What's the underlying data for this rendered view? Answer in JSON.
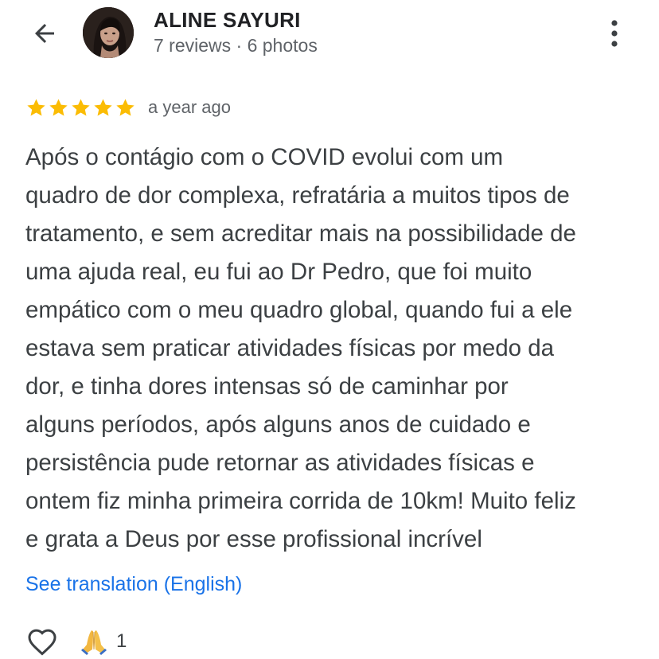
{
  "header": {
    "author_name": "ALINE SAYURI",
    "author_meta": "7 reviews · 6 photos"
  },
  "review": {
    "rating": 5,
    "rating_max": 5,
    "date": "a year ago",
    "text_lines": [
      "Após o contágio com o COVID evolui com um",
      "quadro de dor complexa, refratária a muitos tipos de",
      "tratamento, e sem acreditar mais na possibilidade de",
      "uma ajuda real, eu fui ao Dr Pedro, que foi muito",
      "empático com o meu quadro global, quando fui a ele",
      "estava sem praticar atividades físicas por medo da",
      "dor, e tinha dores intensas só de caminhar por",
      "alguns períodos, após alguns anos de cuidado e",
      "persistência pude retornar as atividades físicas e",
      "ontem fiz minha primeira corrida de 10km! Muito feliz",
      "e grata a Deus por esse profissional incrível"
    ],
    "translation_link": "See translation (English)"
  },
  "actions": {
    "reaction_emoji": "pray-icon",
    "reaction_count": "1"
  },
  "colors": {
    "star": "#FBBC04",
    "link": "#1A73E8",
    "secondary_text": "#5F6368"
  }
}
